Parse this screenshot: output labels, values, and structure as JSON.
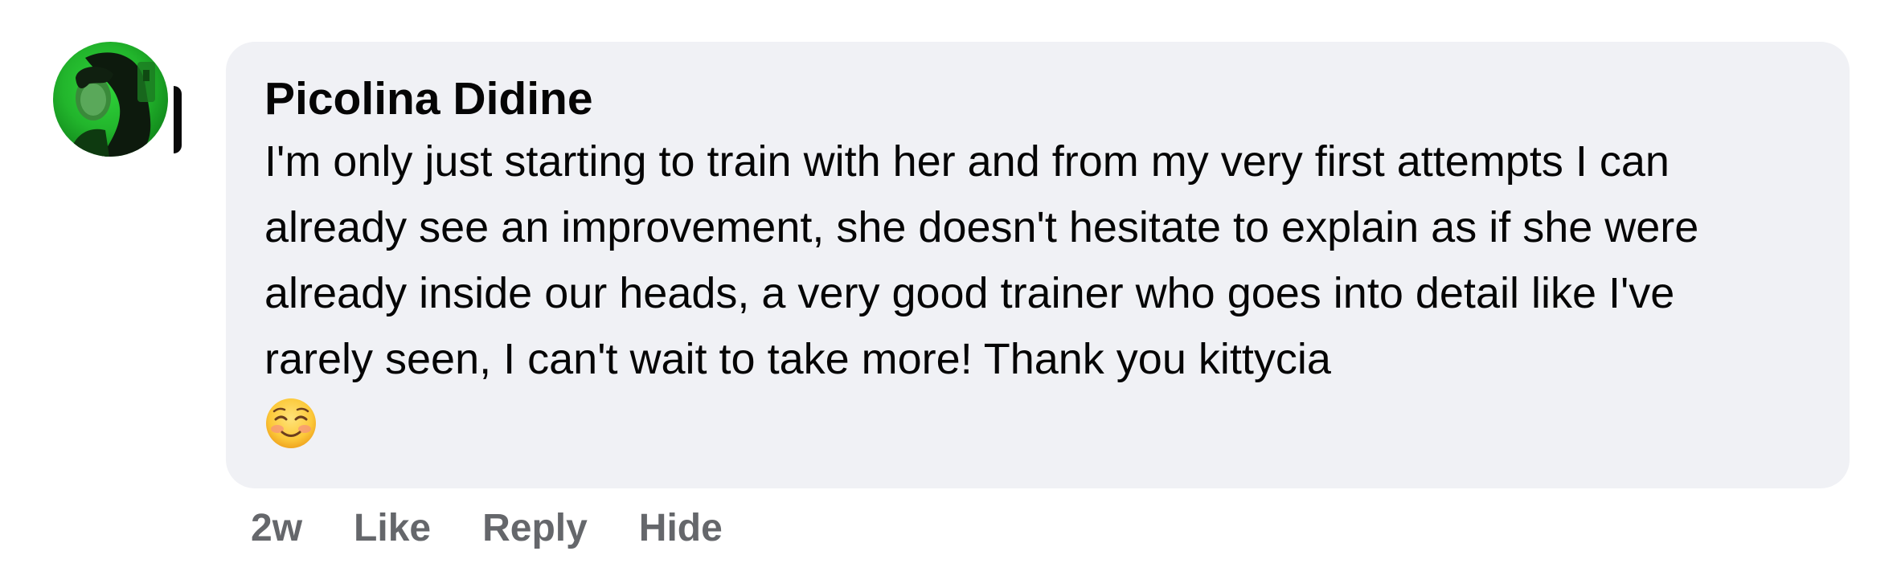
{
  "comment": {
    "author": "Picolina Didine",
    "text": "I'm only just starting to train with her and from my very first attempts I can already see an improvement, she doesn't hesitate to explain as if she were already inside our heads, a very good trainer who goes into detail like I've rarely seen, I can't wait to take more! Thank you kittycia",
    "emoji": "smiling-face-with-blush-icon"
  },
  "actions": {
    "timestamp": "2w",
    "like_label": "Like",
    "reply_label": "Reply",
    "hide_label": "Hide"
  },
  "colors": {
    "bubble_bg": "#f0f1f5",
    "action_text": "#65676b",
    "text": "#050505"
  }
}
